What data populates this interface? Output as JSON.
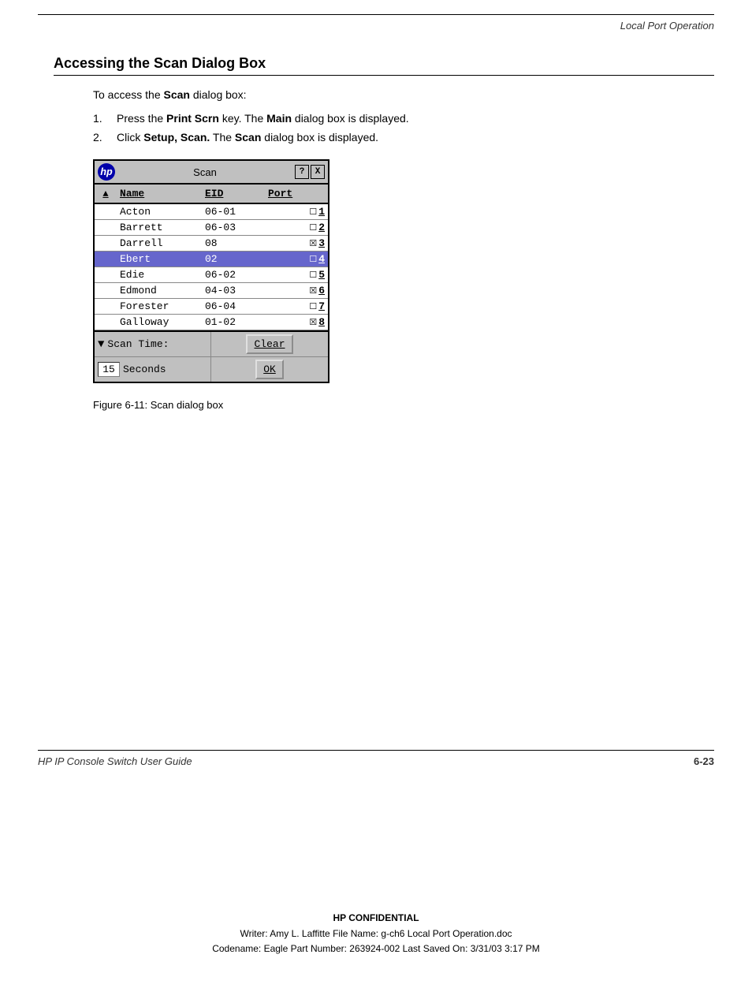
{
  "header": {
    "top_text": "Local Port Operation"
  },
  "section": {
    "title": "Accessing the Scan Dialog Box",
    "intro": "To access the",
    "intro_bold": "Scan",
    "intro_end": "dialog box:",
    "steps": [
      {
        "num": "1.",
        "text": "Press the ",
        "bold1": "Print Scrn",
        "mid1": " key. The ",
        "bold2": "Main",
        "mid2": " dialog box is displayed."
      },
      {
        "num": "2.",
        "text": "Click ",
        "bold1": "Setup, Scan.",
        "mid1": " The ",
        "bold2": "Scan",
        "mid2": " dialog box is displayed."
      }
    ]
  },
  "dialog": {
    "title": "Scan",
    "title_icon": "hp",
    "help_btn": "?",
    "close_btn": "X",
    "columns": {
      "sort": "▲",
      "name": "Name",
      "eid": "EID",
      "port": "Port"
    },
    "rows": [
      {
        "name": "Acton",
        "eid": "",
        "port": "06-01",
        "checked": false,
        "num": "1",
        "selected": false
      },
      {
        "name": "Barrett",
        "eid": "",
        "port": "06-03",
        "checked": false,
        "num": "2",
        "selected": false
      },
      {
        "name": "Darrell",
        "eid": "",
        "port": "08",
        "checked": true,
        "num": "3",
        "selected": false
      },
      {
        "name": "Ebert",
        "eid": "",
        "port": "02",
        "checked": false,
        "num": "4",
        "selected": true
      },
      {
        "name": "Edie",
        "eid": "",
        "port": "06-02",
        "checked": false,
        "num": "5",
        "selected": false
      },
      {
        "name": "Edmond",
        "eid": "",
        "port": "04-03",
        "checked": true,
        "num": "6",
        "selected": false
      },
      {
        "name": "Forester",
        "eid": "",
        "port": "06-04",
        "checked": false,
        "num": "7",
        "selected": false
      },
      {
        "name": "Galloway",
        "eid": "",
        "port": "01-02",
        "checked": true,
        "num": "8",
        "selected": false
      }
    ],
    "footer": {
      "scroll_icon": "▼",
      "scan_time_label": "Scan Time:",
      "scan_time_value": "15",
      "seconds_label": "Seconds",
      "clear_btn": "Clear",
      "ok_btn": "OK"
    }
  },
  "figure_caption": "Figure 6-11:  Scan dialog box",
  "footer": {
    "left": "HP IP Console Switch User Guide",
    "right": "6-23"
  },
  "confidential": {
    "title": "HP CONFIDENTIAL",
    "line1": "Writer: Amy L. Laffitte File Name: g-ch6 Local Port Operation.doc",
    "line2": "Codename: Eagle Part Number: 263924-002 Last Saved On: 3/31/03 3:17 PM"
  }
}
